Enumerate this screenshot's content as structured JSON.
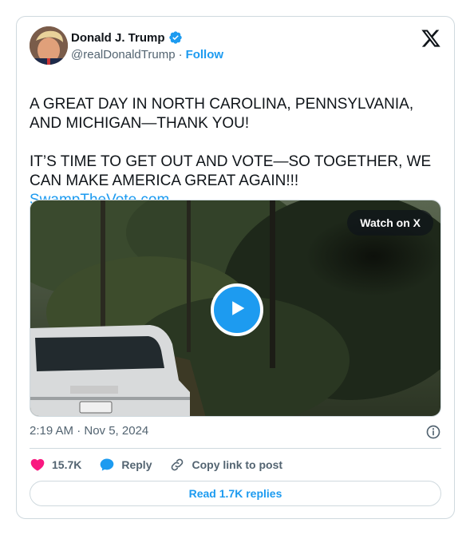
{
  "author": {
    "name": "Donald J. Trump",
    "handle": "@realDonaldTrump",
    "separator": "·",
    "follow_label": "Follow",
    "verified": true
  },
  "tweet": {
    "text": "A GREAT DAY IN NORTH CAROLINA, PENNSYLVANIA, AND MICHIGAN—THANK YOU!\n\nIT’S TIME TO GET OUT AND VOTE—SO TOGETHER, WE CAN MAKE AMERICA GREAT AGAIN!!!",
    "link": "SwampTheVote.com"
  },
  "media": {
    "watch_label": "Watch on X",
    "type": "video"
  },
  "meta": {
    "timestamp": "2:19 AM · Nov 5, 2024"
  },
  "actions": {
    "likes": "15.7K",
    "reply_label": "Reply",
    "copy_label": "Copy link to post"
  },
  "replies_button": "Read 1.7K replies",
  "colors": {
    "accent": "#1d9bf0",
    "like": "#f91880",
    "text": "#0f1419",
    "muted": "#536471",
    "border": "#cfd9de"
  },
  "icons": [
    "verified-badge-icon",
    "x-logo-icon",
    "play-icon",
    "info-icon",
    "heart-icon",
    "reply-bubble-icon",
    "link-icon"
  ]
}
